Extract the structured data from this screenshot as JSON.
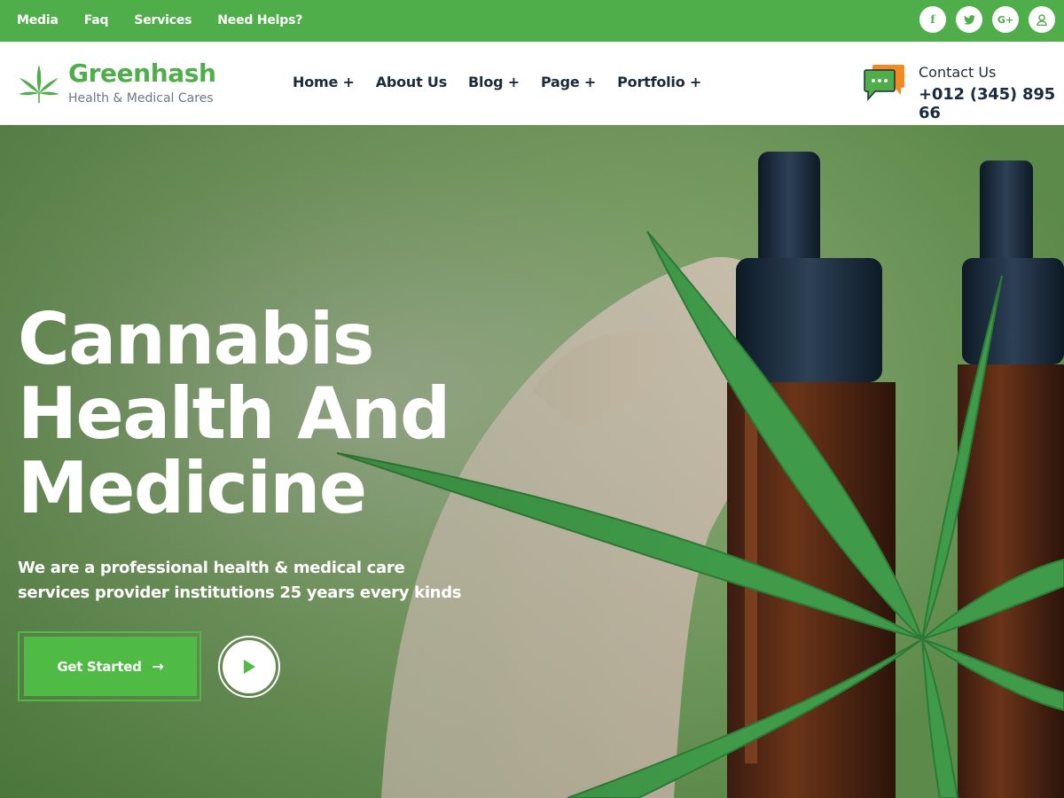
{
  "topbar": {
    "links": [
      "Media",
      "Faq",
      "Services",
      "Need Helps?"
    ],
    "socials": [
      {
        "icon": "facebook-icon",
        "glyph": "f"
      },
      {
        "icon": "twitter-icon",
        "glyph": "t"
      },
      {
        "icon": "google-plus-icon",
        "glyph": "G+"
      },
      {
        "icon": "user-icon",
        "glyph": "☺"
      }
    ],
    "color": "#4fad4a"
  },
  "header": {
    "brand": "Greenhash",
    "tagline": "Health & Medical Cares",
    "nav": [
      "Home +",
      "About Us",
      "Blog +",
      "Page +",
      "Portfolio +"
    ],
    "contact_label": "Contact Us",
    "contact_phone": "+012 (345) 895 66"
  },
  "hero": {
    "title_lines": [
      "Cannabis",
      "Health And",
      "Medicine"
    ],
    "subtitle": "We are a professional health & medical care services provider institutions 25 years every kinds",
    "cta_label": "Get Started",
    "cta_arrow": "→",
    "accent": "#4fbb44"
  }
}
